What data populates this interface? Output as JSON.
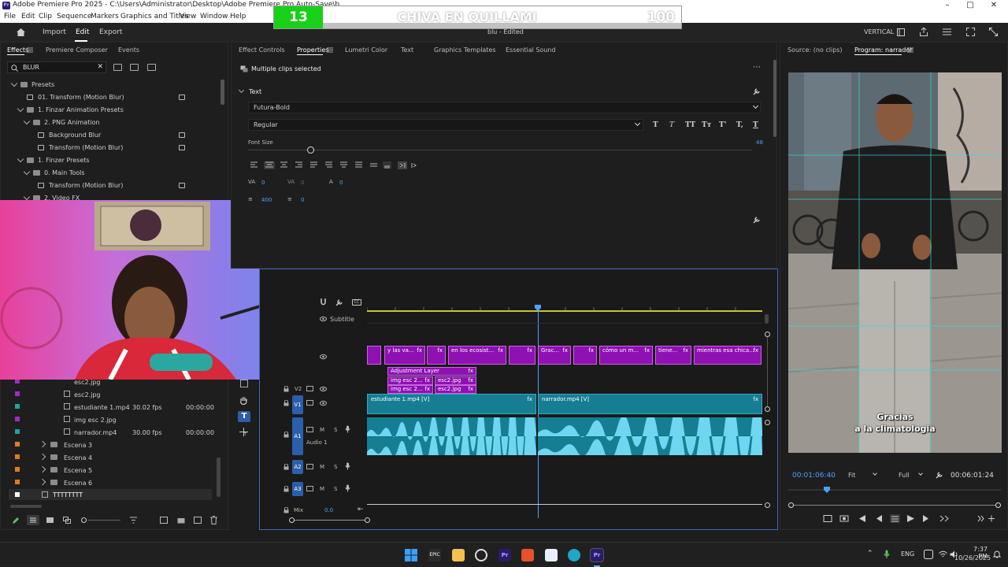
{
  "window": {
    "title": "Adobe Premiere Pro 2025 - C:\\Users\\Administrator\\Desktop\\Adobe Premiere Pro Auto-Save\\b",
    "logo_text": "Pr"
  },
  "menu": [
    "File",
    "Edit",
    "Clip",
    "Sequence",
    "Markers",
    "Graphics and Titles",
    "View",
    "Window",
    "Help"
  ],
  "banner": {
    "number": "13",
    "title": "CHIVA EN QUILLAMI",
    "score": "100"
  },
  "header": {
    "tabs": [
      "Import",
      "Edit",
      "Export"
    ],
    "project_name": "blu - Edited",
    "workspace": "VERTICAL"
  },
  "effects_panel": {
    "tabs": [
      "Effects",
      "Premiere Composer",
      "Events"
    ],
    "search_value": "BLUR",
    "tree": [
      "Presets",
      "01. Transform (Motion Blur)",
      "1. Finzar Animation Presets",
      "2. PNG Animation",
      "Background Blur",
      "Transform (Motion Blur)",
      "1. Finzer Presets",
      "0. Main Tools",
      "Transform (Motion Blur)",
      "2. Video FX"
    ],
    "project_items": [
      {
        "name": "esc2.jpg",
        "fps": "",
        "time": ""
      },
      {
        "name": "esc2.jpg",
        "fps": "",
        "time": ""
      },
      {
        "name": "estudiante 1.mp4",
        "fps": "30.02 fps",
        "time": "00:00:00"
      },
      {
        "name": "img esc 2.jpg",
        "fps": "",
        "time": ""
      },
      {
        "name": "narrador.mp4",
        "fps": "30.00 fps",
        "time": "00:00:00"
      }
    ],
    "bins": [
      "Escena 3",
      "Escena 4",
      "Escena 5",
      "Escena 6",
      "TTTTTTTT"
    ]
  },
  "properties_panel": {
    "tabs": [
      "Effect Controls",
      "Properties",
      "Lumetri Color",
      "Text",
      "Graphics Templates",
      "Essential Sound"
    ],
    "selection": "Multiple clips selected",
    "section": "Text",
    "font": "Futura-Bold",
    "style": "Regular",
    "font_size_label": "Font Size",
    "font_size_value": "48",
    "text_style_buttons": [
      "T",
      "T",
      "TT",
      "Tт",
      "T'",
      "T,",
      "T"
    ],
    "kerning": [
      "0",
      "0",
      "0",
      "400",
      "0"
    ]
  },
  "program_panel": {
    "source_tab": "Source: (no clips)",
    "program_tab": "Program: narrador",
    "caption_line1": "Gracias",
    "caption_line2": "a la climatologia",
    "timecode_current": "00:01:06:40",
    "timecode_total": "00:06:01:24",
    "zoom": "Fit",
    "quality": "Full"
  },
  "timeline": {
    "subtitle_track": "Subtitle",
    "caption_clips": [
      "y las va...",
      "en los ecosist...",
      "Grac...",
      "cómo un m...",
      "tiene...",
      "mientras esa chica..."
    ],
    "adjustment_layer": "Adjustment Layer",
    "img_clips": [
      "img esc 2...",
      "esc2.jpg",
      "img esc 2...",
      "esc2.jpg"
    ],
    "v1_clips": [
      "estudiante 1.mp4 [V]",
      "narrador.mp4 [V]"
    ],
    "tracks": [
      "V2",
      "V1",
      "A1",
      "A2",
      "A3"
    ],
    "audio_label": "Audio 1",
    "mix_label": "Mix",
    "mix_value": "0.0",
    "fx_label": "fx"
  },
  "taskbar": {
    "lang": "ENG",
    "time": "7:37 PM",
    "date": "10/26/2025"
  },
  "colors": {
    "purple_clip": "#8f10b3",
    "teal_clip": "#157e93",
    "accent_blue": "#3a6bb8",
    "banner_green": "#19d019"
  }
}
